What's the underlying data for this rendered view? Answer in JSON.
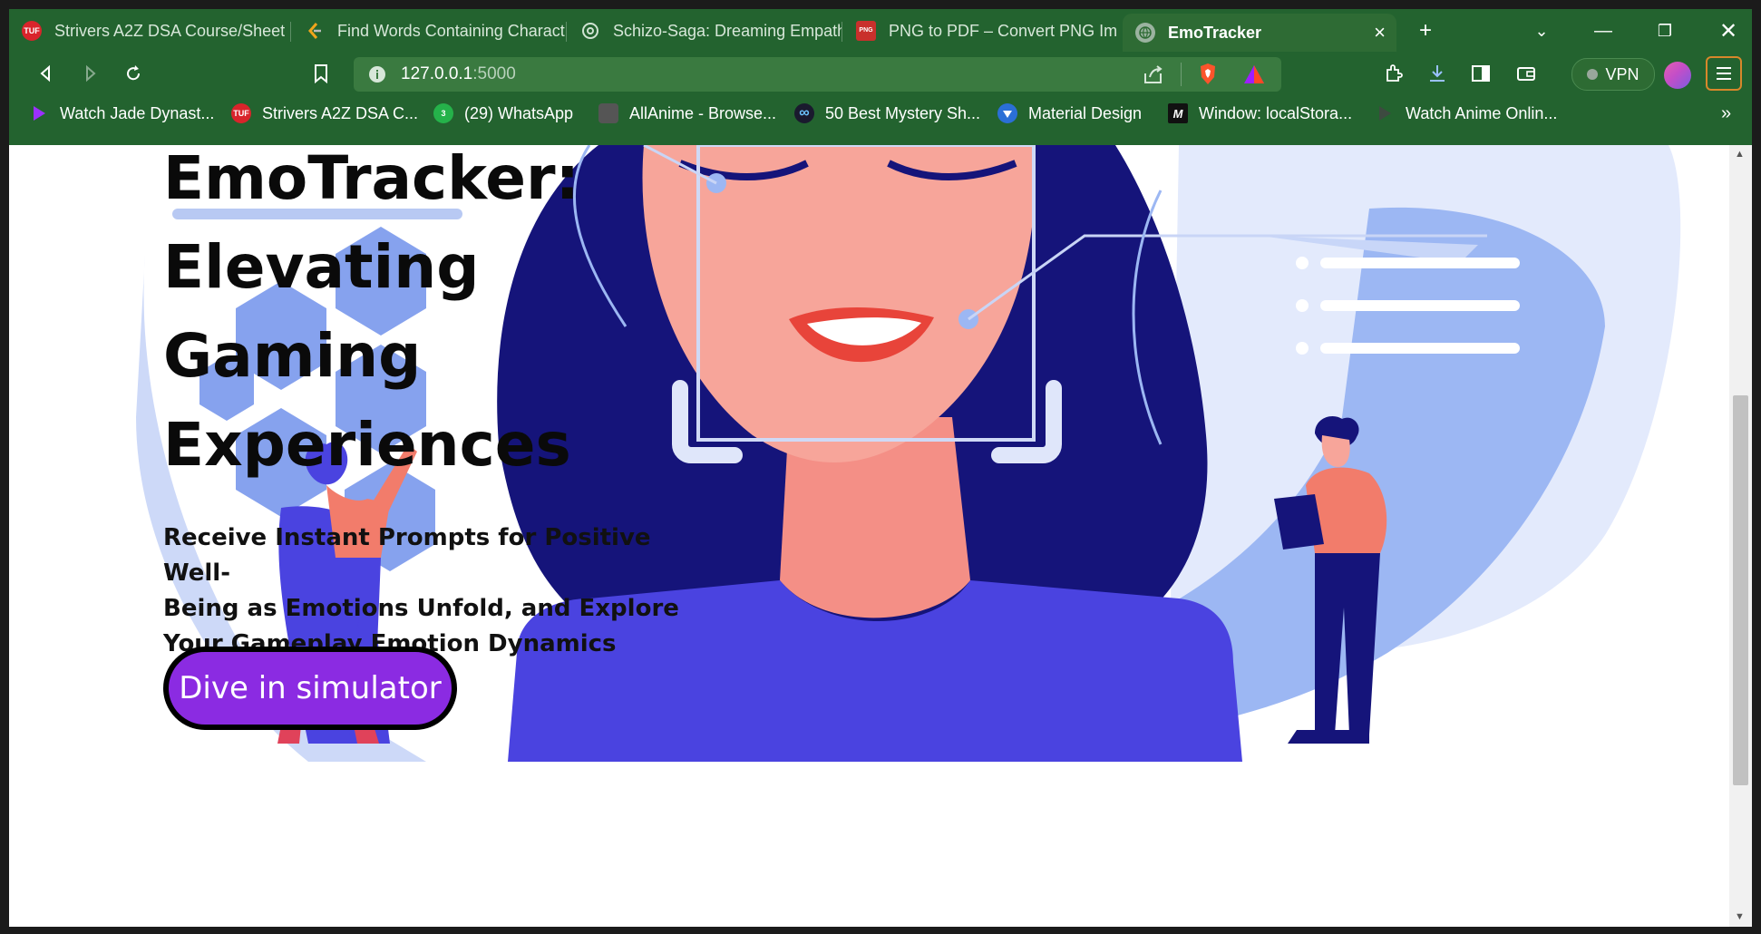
{
  "tabs": [
    {
      "title": "Strivers A2Z DSA Course/Sheet",
      "icon": "tuf-logo-icon",
      "color": "#d9242b",
      "icon_text": "TUF"
    },
    {
      "title": "Find Words Containing Charact",
      "icon": "leetcode-icon",
      "color": "#f0a41c",
      "icon_text": ""
    },
    {
      "title": "Schizo-Saga: Dreaming Empath",
      "icon": "chatgpt-icon",
      "color": "#7fb08a",
      "icon_text": ""
    },
    {
      "title": "PNG to PDF – Convert PNG Ima",
      "icon": "png-pdf-icon",
      "color": "#c9302c",
      "icon_text": "PNG"
    },
    {
      "title": "EmoTracker",
      "icon": "globe-icon",
      "color": "#9bb3a0",
      "icon_text": ""
    }
  ],
  "omnibox": {
    "host": "127.0.0.1",
    "port": ":5000"
  },
  "vpn_label": "VPN",
  "bookmarks": [
    {
      "label": "Watch Jade Dynast...",
      "icon": "play-icon",
      "color": "#8a2be2",
      "icon_text": ""
    },
    {
      "label": "Strivers A2Z DSA C...",
      "icon": "tuf-logo-icon",
      "color": "#d9242b",
      "icon_text": "TUF"
    },
    {
      "label": "(29) WhatsApp",
      "icon": "whatsapp-icon",
      "color": "#25b24a",
      "icon_text": "3"
    },
    {
      "label": "AllAnime - Browse...",
      "icon": "allanime-icon",
      "color": "#444444",
      "icon_text": ""
    },
    {
      "label": "50 Best Mystery Sh...",
      "icon": "infinity-icon",
      "color": "#1a1a2e",
      "icon_text": "∞"
    },
    {
      "label": "Material Design",
      "icon": "material-icon",
      "color": "#2b6fd6",
      "icon_text": ""
    },
    {
      "label": "Window: localStora...",
      "icon": "mdn-icon",
      "color": "#111111",
      "icon_text": "M"
    },
    {
      "label": "Watch Anime Onlin...",
      "icon": "play-icon",
      "color": "#333333",
      "icon_text": ""
    }
  ],
  "bookmarks_overflow": "»",
  "hero": {
    "title_lines": [
      "EmoTracker:",
      "Elevating",
      "Gaming",
      "Experiences"
    ],
    "subtitle_lines": [
      "Receive Instant Prompts for Positive Well-",
      "Being as Emotions Unfold, and Explore",
      "Your Gameplay Emotion Dynamics"
    ],
    "cta_label": "Dive in simulator"
  },
  "colors": {
    "chrome": "#23632f",
    "cta": "#8b2be2",
    "illustration_navy": "#15147a",
    "illustration_skin": "#f7a59a",
    "illustration_blue": "#4a43e0"
  }
}
